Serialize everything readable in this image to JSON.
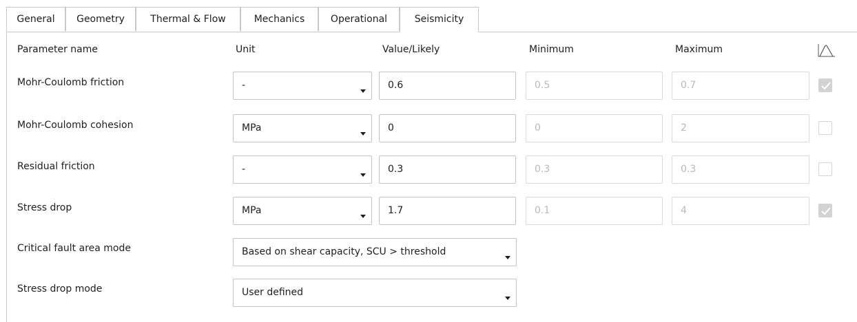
{
  "tabs": [
    {
      "label": "General"
    },
    {
      "label": "Geometry"
    },
    {
      "label": "Thermal & Flow"
    },
    {
      "label": "Mechanics"
    },
    {
      "label": "Operational"
    },
    {
      "label": "Seismicity",
      "active": true
    }
  ],
  "headers": {
    "parameter_name": "Parameter name",
    "unit": "Unit",
    "value": "Value/Likely",
    "minimum": "Minimum",
    "maximum": "Maximum",
    "distribution_icon": "distribution-curve-icon"
  },
  "rows": [
    {
      "name": "Mohr-Coulomb friction",
      "unit": "-",
      "value": "0.6",
      "min": "0.5",
      "max": "0.7",
      "checked": true
    },
    {
      "name": "Mohr-Coulomb cohesion",
      "unit": "MPa",
      "value": "0",
      "min": "0",
      "max": "2",
      "checked": false
    },
    {
      "name": "Residual friction",
      "unit": "-",
      "value": "0.3",
      "min": "0.3",
      "max": "0.3",
      "checked": false
    },
    {
      "name": "Stress drop",
      "unit": "MPa",
      "value": "1.7",
      "min": "0.1",
      "max": "4",
      "checked": true
    }
  ],
  "modes": [
    {
      "name": "Critical fault area mode",
      "value": "Based on shear capacity, SCU > threshold"
    },
    {
      "name": "Stress drop mode",
      "value": "User defined"
    }
  ]
}
